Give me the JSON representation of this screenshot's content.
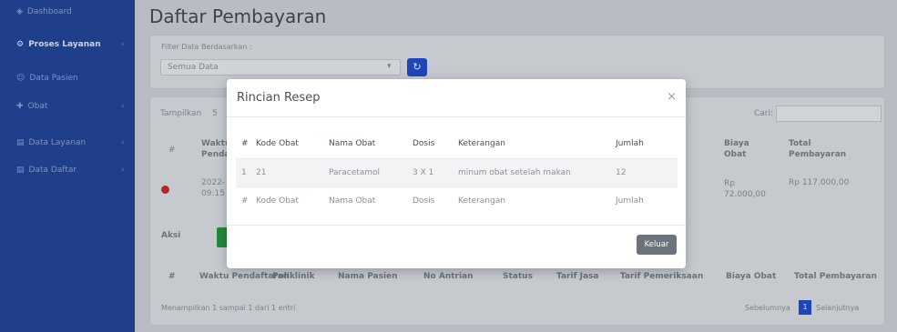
{
  "sidebar": {
    "items": [
      {
        "label": "Dashboard",
        "icon": "dashboard-icon"
      },
      {
        "label": "Proses Layanan",
        "icon": "gear-icon",
        "active": true
      },
      {
        "label": "Data Pasien",
        "icon": "users-icon"
      },
      {
        "label": "Obat",
        "icon": "pill-icon"
      },
      {
        "label": "Data Layanan",
        "icon": "list-icon"
      },
      {
        "label": "Data Daftar",
        "icon": "list-icon"
      }
    ]
  },
  "page": {
    "title": "Daftar Pembayaran",
    "filter_label": "Filter Data Berdasarkan :",
    "filter_value": "Semua Data",
    "show_label": "Tampilkan",
    "show_value": "5",
    "search_label": "Cari:",
    "col_waktu": "Waktu Penda",
    "col_biaya_obat": "Biaya Obat",
    "col_total": "Total Pembayaran",
    "row_date": "2022-",
    "row_time": "09:15",
    "row_biaya": "Rp 72.000,00",
    "row_total": "Rp 117.000,00",
    "aksi_label": "Aksi",
    "footer_cols": [
      "#",
      "Waktu Pendaftaran",
      "Poliklinik",
      "Nama Pasien",
      "No Antrian",
      "Status",
      "Tarif Jasa",
      "Tarif Pemeriksaan",
      "Biaya Obat",
      "Total Pembayaran"
    ],
    "info": "Menampilkan 1 sampai 1 dari 1 entri",
    "prev": "Sebelumnya",
    "current_page": "1",
    "next": "Selanjutnya"
  },
  "modal": {
    "title": "Rincian Resep",
    "close": "×",
    "headers": [
      "#",
      "Kode Obat",
      "Nama Obat",
      "Dosis",
      "Keterangan",
      "Jumlah"
    ],
    "rows": [
      {
        "no": "1",
        "kode": "21",
        "nama": "Paracetamol",
        "dosis": "3 X 1",
        "keterangan": "minum obat setelah makan",
        "jumlah": "12"
      }
    ],
    "keluar_label": "Keluar"
  },
  "colors": {
    "sidebar": "#1f3f8a",
    "primary": "#1f46b8",
    "secondary": "#6c737c"
  }
}
